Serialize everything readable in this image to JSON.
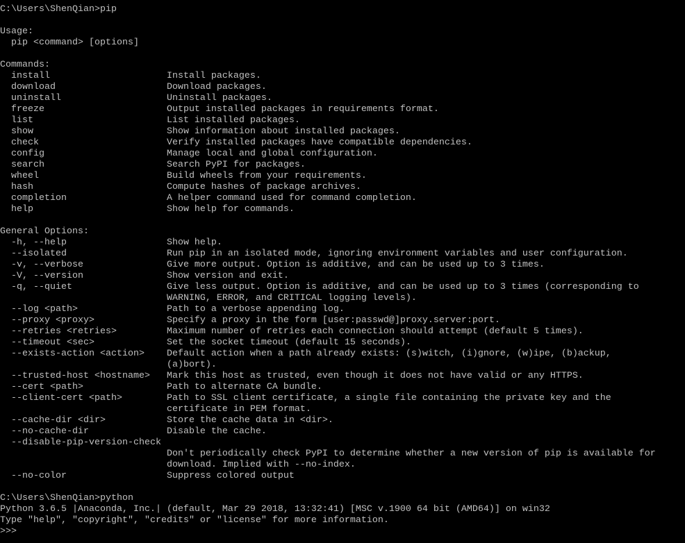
{
  "window": {
    "background": "#000000",
    "foreground": "#c0c0c0"
  },
  "session": [
    {
      "type": "prompt",
      "prompt": "C:\\Users\\ShenQian>",
      "command": "pip"
    },
    {
      "type": "blank"
    },
    {
      "type": "text",
      "text": "Usage:"
    },
    {
      "type": "text",
      "text": "  pip <command> [options]"
    },
    {
      "type": "blank"
    },
    {
      "type": "section",
      "title": "Commands:",
      "items": [
        {
          "name": "install",
          "desc": [
            "Install packages."
          ]
        },
        {
          "name": "download",
          "desc": [
            "Download packages."
          ]
        },
        {
          "name": "uninstall",
          "desc": [
            "Uninstall packages."
          ]
        },
        {
          "name": "freeze",
          "desc": [
            "Output installed packages in requirements format."
          ]
        },
        {
          "name": "list",
          "desc": [
            "List installed packages."
          ]
        },
        {
          "name": "show",
          "desc": [
            "Show information about installed packages."
          ]
        },
        {
          "name": "check",
          "desc": [
            "Verify installed packages have compatible dependencies."
          ]
        },
        {
          "name": "config",
          "desc": [
            "Manage local and global configuration."
          ]
        },
        {
          "name": "search",
          "desc": [
            "Search PyPI for packages."
          ]
        },
        {
          "name": "wheel",
          "desc": [
            "Build wheels from your requirements."
          ]
        },
        {
          "name": "hash",
          "desc": [
            "Compute hashes of package archives."
          ]
        },
        {
          "name": "completion",
          "desc": [
            "A helper command used for command completion."
          ]
        },
        {
          "name": "help",
          "desc": [
            "Show help for commands."
          ]
        }
      ]
    },
    {
      "type": "blank"
    },
    {
      "type": "section",
      "title": "General Options:",
      "items": [
        {
          "name": "-h, --help",
          "desc": [
            "Show help."
          ]
        },
        {
          "name": "--isolated",
          "desc": [
            "Run pip in an isolated mode, ignoring environment variables and user configuration."
          ]
        },
        {
          "name": "-v, --verbose",
          "desc": [
            "Give more output. Option is additive, and can be used up to 3 times."
          ]
        },
        {
          "name": "-V, --version",
          "desc": [
            "Show version and exit."
          ]
        },
        {
          "name": "-q, --quiet",
          "desc": [
            "Give less output. Option is additive, and can be used up to 3 times (corresponding to",
            "WARNING, ERROR, and CRITICAL logging levels)."
          ]
        },
        {
          "name": "--log <path>",
          "desc": [
            "Path to a verbose appending log."
          ]
        },
        {
          "name": "--proxy <proxy>",
          "desc": [
            "Specify a proxy in the form [user:passwd@]proxy.server:port."
          ]
        },
        {
          "name": "--retries <retries>",
          "desc": [
            "Maximum number of retries each connection should attempt (default 5 times)."
          ]
        },
        {
          "name": "--timeout <sec>",
          "desc": [
            "Set the socket timeout (default 15 seconds)."
          ]
        },
        {
          "name": "--exists-action <action>",
          "desc": [
            "Default action when a path already exists: (s)witch, (i)gnore, (w)ipe, (b)ackup,",
            "(a)bort)."
          ]
        },
        {
          "name": "--trusted-host <hostname>",
          "desc": [
            "Mark this host as trusted, even though it does not have valid or any HTTPS."
          ]
        },
        {
          "name": "--cert <path>",
          "desc": [
            "Path to alternate CA bundle."
          ]
        },
        {
          "name": "--client-cert <path>",
          "desc": [
            "Path to SSL client certificate, a single file containing the private key and the",
            "certificate in PEM format."
          ]
        },
        {
          "name": "--cache-dir <dir>",
          "desc": [
            "Store the cache data in <dir>."
          ]
        },
        {
          "name": "--no-cache-dir",
          "desc": [
            "Disable the cache."
          ]
        },
        {
          "name": "--disable-pip-version-check",
          "desc": [
            "Don't periodically check PyPI to determine whether a new version of pip is available for",
            "download. Implied with --no-index."
          ]
        },
        {
          "name": "--no-color",
          "desc": [
            "Suppress colored output"
          ]
        }
      ]
    },
    {
      "type": "blank"
    },
    {
      "type": "prompt",
      "prompt": "C:\\Users\\ShenQian>",
      "command": "python"
    },
    {
      "type": "text",
      "text": "Python 3.6.5 |Anaconda, Inc.| (default, Mar 29 2018, 13:32:41) [MSC v.1900 64 bit (AMD64)] on win32"
    },
    {
      "type": "text",
      "text": "Type \"help\", \"copyright\", \"credits\" or \"license\" for more information."
    },
    {
      "type": "prompt",
      "prompt": ">>> ",
      "command": ""
    }
  ]
}
